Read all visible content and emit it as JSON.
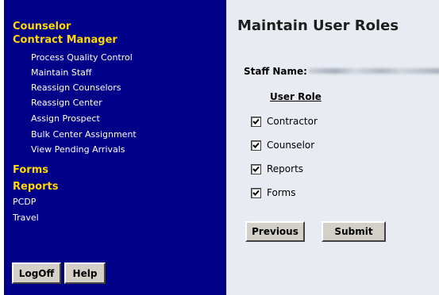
{
  "sidebar": {
    "counselor": "Counselor",
    "contract_manager": "Contract Manager",
    "sub_items": [
      "Process Quality Control",
      "Maintain Staff",
      "Reassign Counselors",
      "Reassign Center",
      "Assign Prospect",
      "Bulk Center Assignment",
      "View Pending Arrivals"
    ],
    "forms": "Forms",
    "reports": "Reports",
    "pcdp": "PCDP",
    "travel": "Travel",
    "logoff_label": "LogOff",
    "help_label": "Help"
  },
  "main": {
    "title": "Maintain User Roles",
    "staff_name_label": "Staff Name:",
    "role_header": "User Role",
    "roles": [
      {
        "label": "Contractor",
        "checked": true
      },
      {
        "label": "Counselor",
        "checked": true
      },
      {
        "label": "Reports",
        "checked": true
      },
      {
        "label": "Forms",
        "checked": true
      }
    ],
    "previous_label": "Previous",
    "submit_label": "Submit"
  },
  "colors": {
    "sidebar_bg": "#000088",
    "major_link": "#ffd700",
    "main_bg": "#e8ecf2",
    "button_face": "#d4d0c8"
  },
  "icons": {
    "checkbox": "checkmark-icon"
  }
}
